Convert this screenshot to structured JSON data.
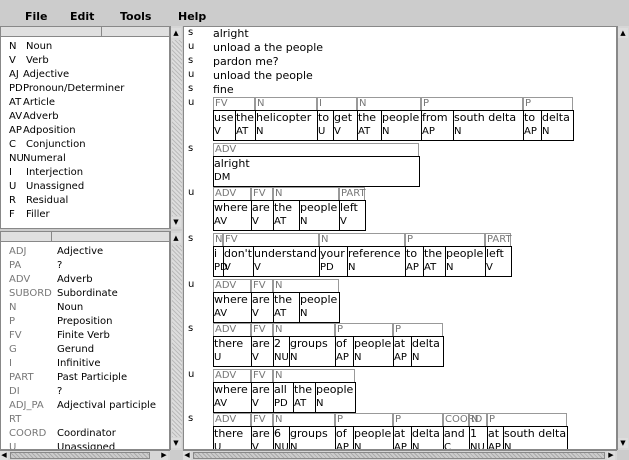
{
  "menu": [
    "File",
    "Edit",
    "Tools",
    "Help"
  ],
  "pos_tags": [
    {
      "code": "N",
      "desc": "Noun"
    },
    {
      "code": "V",
      "desc": "Verb"
    },
    {
      "code": "AJ",
      "desc": "Adjective"
    },
    {
      "code": "PD",
      "desc": "Pronoun/Determiner"
    },
    {
      "code": "AT",
      "desc": "Article"
    },
    {
      "code": "AV",
      "desc": "Adverb"
    },
    {
      "code": "AP",
      "desc": "Adposition"
    },
    {
      "code": "C",
      "desc": "Conjunction"
    },
    {
      "code": "NU",
      "desc": "Numeral"
    },
    {
      "code": "I",
      "desc": "Interjection"
    },
    {
      "code": "U",
      "desc": "Unassigned"
    },
    {
      "code": "R",
      "desc": "Residual"
    },
    {
      "code": "F",
      "desc": "Filler"
    }
  ],
  "chunk_tags": [
    {
      "code": "ADJ",
      "desc": "Adjective"
    },
    {
      "code": "PA",
      "desc": "?"
    },
    {
      "code": "ADV",
      "desc": "Adverb"
    },
    {
      "code": "SUBORD",
      "desc": "Subordinate"
    },
    {
      "code": "N",
      "desc": "Noun"
    },
    {
      "code": "P",
      "desc": "Preposition"
    },
    {
      "code": "FV",
      "desc": "Finite Verb"
    },
    {
      "code": "G",
      "desc": "Gerund"
    },
    {
      "code": "I",
      "desc": "Infinitive"
    },
    {
      "code": "PART",
      "desc": "Past Participle"
    },
    {
      "code": "DI",
      "desc": "?"
    },
    {
      "code": "ADJ_PA",
      "desc": "Adjectival participle"
    },
    {
      "code": "RT",
      "desc": ""
    },
    {
      "code": "COORD",
      "desc": "Coordinator"
    },
    {
      "code": "U",
      "desc": "Unassigned"
    }
  ],
  "plain_lines": [
    {
      "spk": "s",
      "text": "alright"
    },
    {
      "spk": "u",
      "text": "unload a the people"
    },
    {
      "spk": "s",
      "text": "pardon me?"
    },
    {
      "spk": "u",
      "text": "unload the people"
    },
    {
      "spk": "s",
      "text": "fine"
    }
  ],
  "annotated": [
    {
      "spk": "u",
      "chunks": [
        "FV",
        "N",
        "I",
        "N",
        "P",
        "P"
      ],
      "tokens": [
        [
          "use",
          "V"
        ],
        [
          "the",
          "AT"
        ],
        [
          "helicopter",
          "N"
        ],
        [
          "to",
          "U"
        ],
        [
          "get",
          "V"
        ],
        [
          "the",
          "AT"
        ],
        [
          "people",
          "N"
        ],
        [
          "from",
          "AP"
        ],
        [
          "south delta",
          "N"
        ],
        [
          "to",
          "AP"
        ],
        [
          "delta",
          "N"
        ]
      ]
    },
    {
      "spk": "s",
      "chunks": [
        "ADV"
      ],
      "tokens": [
        [
          "alright",
          "DM"
        ]
      ]
    },
    {
      "spk": "u",
      "chunks": [
        "ADV",
        "FV",
        "N",
        "PART"
      ],
      "tokens": [
        [
          "where",
          "AV"
        ],
        [
          "are",
          "V"
        ],
        [
          "the",
          "AT"
        ],
        [
          "people",
          "N"
        ],
        [
          "left",
          "V"
        ]
      ]
    },
    {
      "spk": "s",
      "chunks": [
        "N",
        "FV",
        "N",
        "P",
        "PART"
      ],
      "tokens": [
        [
          "i",
          "PD"
        ],
        [
          "don't",
          "V"
        ],
        [
          "understand",
          "V"
        ],
        [
          "your",
          "PD"
        ],
        [
          "reference",
          "N"
        ],
        [
          "to",
          "AP"
        ],
        [
          "the",
          "AT"
        ],
        [
          "people",
          "N"
        ],
        [
          "left",
          "V"
        ]
      ]
    },
    {
      "spk": "u",
      "chunks": [
        "ADV",
        "FV",
        "N"
      ],
      "tokens": [
        [
          "where",
          "AV"
        ],
        [
          "are",
          "V"
        ],
        [
          "the",
          "AT"
        ],
        [
          "people",
          "N"
        ]
      ]
    },
    {
      "spk": "s",
      "chunks": [
        "ADV",
        "FV",
        "N",
        "P",
        "P"
      ],
      "tokens": [
        [
          "there",
          "U"
        ],
        [
          "are",
          "V"
        ],
        [
          "2",
          "NU"
        ],
        [
          "groups",
          "N"
        ],
        [
          "of",
          "AP"
        ],
        [
          "people",
          "N"
        ],
        [
          "at",
          "AP"
        ],
        [
          "delta",
          "N"
        ]
      ]
    },
    {
      "spk": "u",
      "chunks": [
        "ADV",
        "FV",
        "N"
      ],
      "tokens": [
        [
          "where",
          "AV"
        ],
        [
          "are",
          "V"
        ],
        [
          "all",
          "PD"
        ],
        [
          "the",
          "AT"
        ],
        [
          "people",
          "N"
        ]
      ]
    },
    {
      "spk": "s",
      "chunks": [
        "ADV",
        "FV",
        "N",
        "P",
        "P",
        "COORD",
        "N",
        "P"
      ],
      "tokens": [
        [
          "there",
          "U"
        ],
        [
          "are",
          "V"
        ],
        [
          "6",
          "NU"
        ],
        [
          "groups",
          "N"
        ],
        [
          "of",
          "AP"
        ],
        [
          "people",
          "N"
        ],
        [
          "at",
          "AP"
        ],
        [
          "delta",
          "N"
        ],
        [
          "and",
          "C"
        ],
        [
          "1",
          "NU"
        ],
        [
          "at",
          "AP"
        ],
        [
          "south delta",
          "N"
        ]
      ]
    }
  ]
}
